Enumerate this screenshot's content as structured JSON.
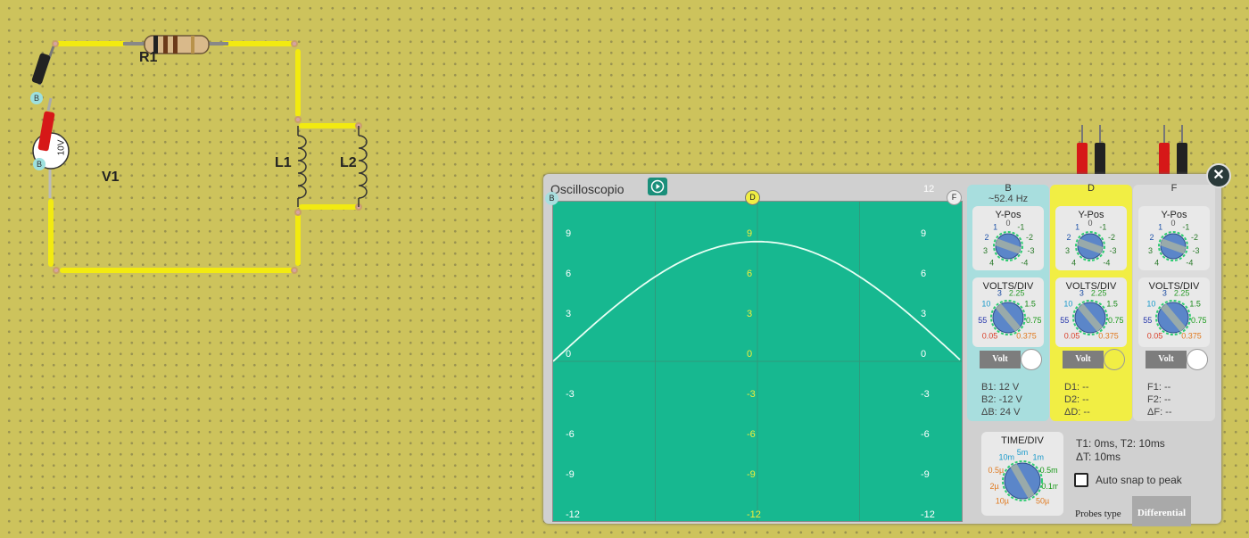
{
  "circuit": {
    "source_label": "V1",
    "source_value": "10V",
    "resistor_label": "R1",
    "inductor1_label": "L1",
    "inductor2_label": "L2",
    "probe_b_top": "B",
    "probe_b_bottom": "B"
  },
  "oscilloscope": {
    "title": "Oscilloscopio",
    "y_labels": [
      "9",
      "6",
      "3",
      "0",
      "-3",
      "-6",
      "-9",
      "-12"
    ],
    "y_top": "12",
    "marker_left": "B",
    "marker_center": "D",
    "marker_right": "F",
    "channels": [
      {
        "id": "B",
        "freq": "~52.4 Hz",
        "ypos_title": "Y-Pos",
        "vdiv_title": "VOLTS/DIV",
        "volt_label": "Volt",
        "m1": "B1: 12 V",
        "m2": "B2: -12 V",
        "m3": "ΔB: 24 V",
        "color": "#a8dede"
      },
      {
        "id": "D",
        "freq": "",
        "ypos_title": "Y-Pos",
        "vdiv_title": "VOLTS/DIV",
        "volt_label": "Volt",
        "m1": "D1: --",
        "m2": "D2: --",
        "m3": "ΔD: --",
        "color": "#f1ee44"
      },
      {
        "id": "F",
        "freq": "",
        "ypos_title": "Y-Pos",
        "vdiv_title": "VOLTS/DIV",
        "volt_label": "Volt",
        "m1": "F1: --",
        "m2": "F2: --",
        "m3": "ΔF: --",
        "color": "#dcdcdc"
      }
    ],
    "ypos_ticks": [
      "4",
      "3",
      "2",
      "1",
      "0",
      "-1",
      "-2",
      "-3",
      "-4"
    ],
    "vdiv_ticks": [
      "0.05",
      "55",
      "10",
      "3",
      "2.25",
      "1.5",
      "0.75",
      "0.375"
    ],
    "time_div_title": "TIME/DIV",
    "time_ticks": [
      "10µ",
      "2µ",
      "0.5µ",
      "10m",
      "5m",
      "1m",
      "0.5m",
      "0.1m",
      "50µ"
    ],
    "t_info": "T1: 0ms, T2: 10ms",
    "dt_info": "ΔT: 10ms",
    "snap_label": "Auto snap to peak",
    "probes_type_label": "Probes type",
    "probes_type_value": "Differential"
  }
}
